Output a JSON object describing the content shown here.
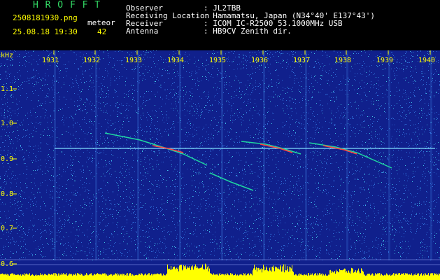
{
  "header": {
    "logo": "H R O F F T",
    "filename": "2508181930.png",
    "datetime": "25.08.18 19:30",
    "meteor_label": "meteor",
    "meteor_count": "42",
    "fields": [
      {
        "label": "Observer",
        "value": ": JL2TBB"
      },
      {
        "label": "Receiving Location",
        "value": ": Hamamatsu, Japan (N34°40' E137°43')"
      },
      {
        "label": "Receiver",
        "value": ": ICOM IC-R2500 53.1000MHz USB"
      },
      {
        "label": "Antenna",
        "value": ": HB9CV Zenith dir."
      }
    ]
  },
  "spectrogram": {
    "y_unit": "kHz",
    "x_ticks": [
      "1931",
      "1932",
      "1933",
      "1934",
      "1935",
      "1936",
      "1937",
      "1938",
      "1939",
      "1940"
    ],
    "y_ticks": [
      "1.1",
      "1.0",
      "0.9",
      "0.8",
      "0.7",
      "0.6"
    ],
    "colors": {
      "background": "#10208c",
      "noise": "#2f6ed8",
      "trace": "#1fd6a0",
      "hot": "#ff4040",
      "bars": "#ffff00",
      "carrier": "#80e0ff"
    }
  }
}
